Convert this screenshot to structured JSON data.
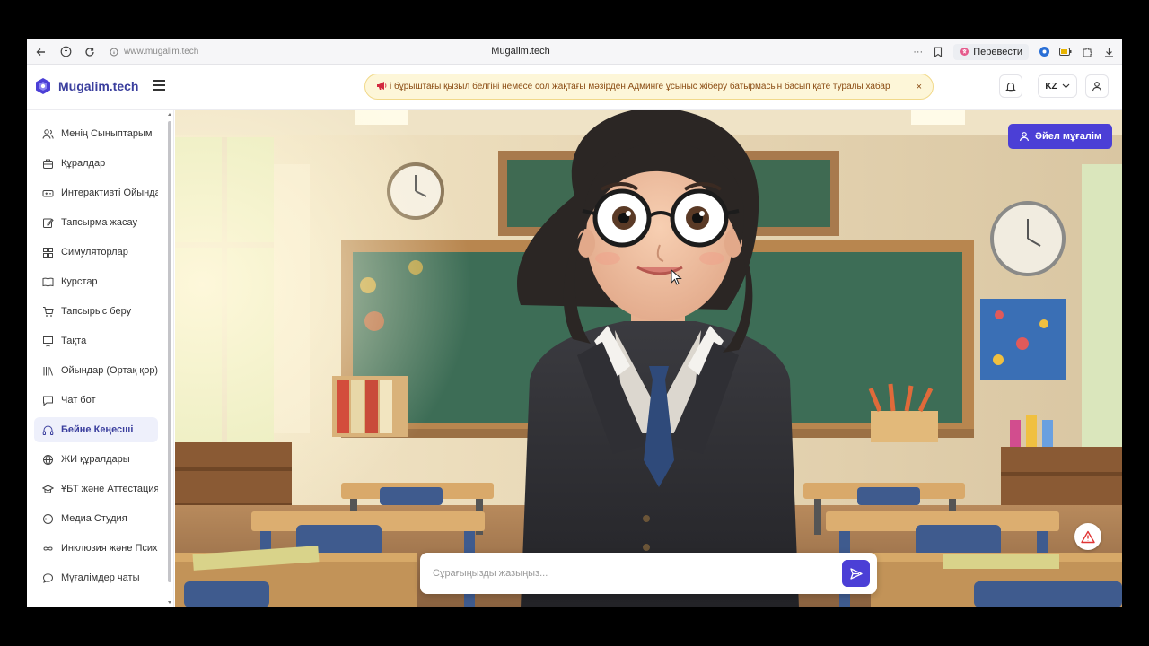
{
  "browser": {
    "url": "www.mugalim.tech",
    "title": "Mugalim.tech",
    "translate_label": "Перевести",
    "more_label": "···"
  },
  "header": {
    "brand": "Mugalim.tech",
    "banner_icon": "megaphone-icon",
    "banner_text": "і бұрыштағы қызыл белгіні немесе сол жақтағы мәзірден Админге ұсыныс жіберу батырмасын басып қате туралы хабар",
    "banner_close": "×",
    "language": "KZ"
  },
  "sidebar": {
    "items": [
      {
        "label": "Менің Сыныптарым",
        "icon": "users-icon"
      },
      {
        "label": "Құралдар",
        "icon": "briefcase-icon"
      },
      {
        "label": "Интерактивті Ойында",
        "icon": "gamepad-icon"
      },
      {
        "label": "Тапсырма жасау",
        "icon": "edit-icon"
      },
      {
        "label": "Симуляторлар",
        "icon": "grid-icon"
      },
      {
        "label": "Курстар",
        "icon": "book-open-icon"
      },
      {
        "label": "Тапсырыс беру",
        "icon": "cart-icon"
      },
      {
        "label": "Тақта",
        "icon": "presentation-icon"
      },
      {
        "label": "Ойындар (Ортақ қор)",
        "icon": "library-icon"
      },
      {
        "label": "Чат бот",
        "icon": "message-icon"
      },
      {
        "label": "Бейне Кеңесші",
        "icon": "headphones-icon",
        "active": true
      },
      {
        "label": "ЖИ құралдары",
        "icon": "globe-icon"
      },
      {
        "label": "ҰБТ және Аттестация",
        "icon": "graduation-cap-icon"
      },
      {
        "label": "Медиа Студия",
        "icon": "media-icon"
      },
      {
        "label": "Инклюзия және Психо",
        "icon": "infinity-icon"
      },
      {
        "label": "Мұғалімдер чаты",
        "icon": "chat-bubble-icon"
      }
    ]
  },
  "main": {
    "avatar_button": "Әйел мұғалім",
    "chat_placeholder": "Сұрағыңызды жазыңыз...",
    "chat_value": ""
  },
  "colors": {
    "accent": "#4B3FD6",
    "brand_text": "#3B3F9E",
    "banner_bg": "#FDF6D8",
    "banner_text": "#8A4B12"
  }
}
